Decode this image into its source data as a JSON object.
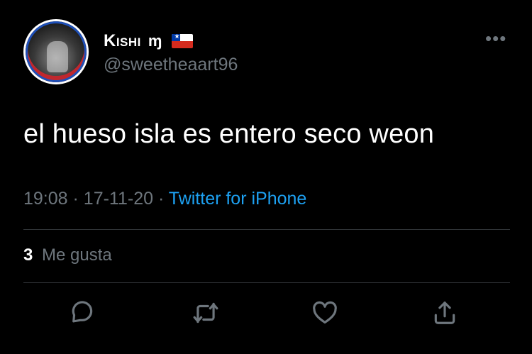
{
  "tweet": {
    "author": {
      "display_name": "Kishi",
      "name_glyph": "ɱ",
      "flag": "chile-flag",
      "handle": "@sweetheaart96"
    },
    "text": "el hueso isla es entero seco weon",
    "timestamp": {
      "time": "19:08",
      "separator1": "·",
      "date": "17-11-20",
      "separator2": "·",
      "source": "Twitter for iPhone"
    },
    "stats": {
      "likes_count": "3",
      "likes_label": "Me gusta"
    },
    "actions": [
      {
        "name": "reply",
        "icon": "reply-icon"
      },
      {
        "name": "retweet",
        "icon": "retweet-icon"
      },
      {
        "name": "like",
        "icon": "heart-icon"
      },
      {
        "name": "share",
        "icon": "share-icon"
      }
    ],
    "more_menu_icon": "more-icon"
  },
  "colors": {
    "background": "#000000",
    "text_primary": "#ffffff",
    "text_secondary": "#6e767d",
    "link": "#1da1f2",
    "divider": "#2f3336"
  }
}
